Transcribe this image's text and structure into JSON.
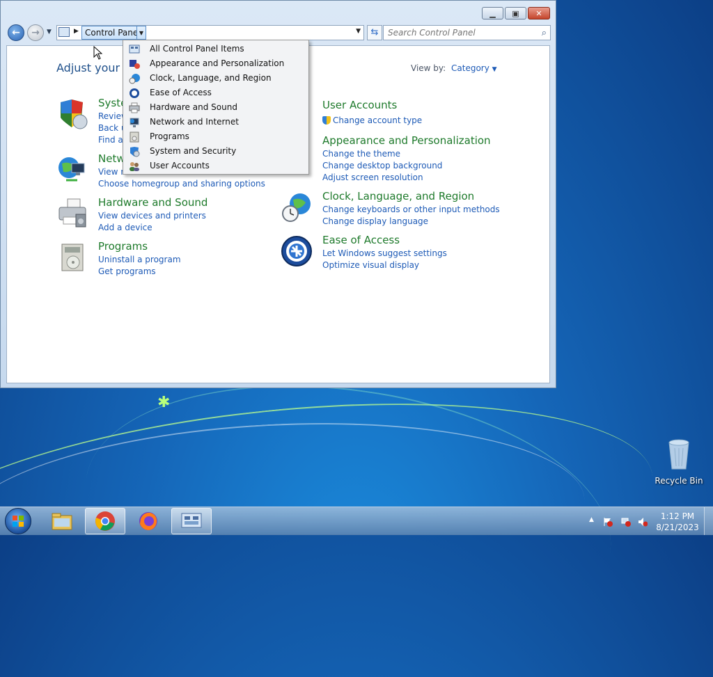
{
  "window": {
    "caption_buttons": {
      "minimize": "minimize-icon",
      "maximize": "maximize-icon",
      "close": "close-icon"
    },
    "nav": {
      "breadcrumb": "Control Panel",
      "search_placeholder": "Search Control Panel"
    },
    "content": {
      "heading": "Adjust your co",
      "view_by_label": "View by:",
      "view_by_value": "Category",
      "left_categories": [
        {
          "title": "Syste",
          "links": [
            "Review",
            "Back u",
            "Find ar"
          ],
          "icon": "shield-icon"
        },
        {
          "title": "Netw",
          "links": [
            "View n",
            "Choose homegroup and sharing options"
          ],
          "icon": "network-globe-icon"
        },
        {
          "title": "Hardware and Sound",
          "links": [
            "View devices and printers",
            "Add a device"
          ],
          "icon": "printer-icon"
        },
        {
          "title": "Programs",
          "links": [
            "Uninstall a program",
            "Get programs"
          ],
          "icon": "programs-icon"
        }
      ],
      "right_categories": [
        {
          "title": "User Accounts",
          "links": [
            "Change account type"
          ],
          "icon": "users-icon"
        },
        {
          "title": "Appearance and Personalization",
          "links": [
            "Change the theme",
            "Change desktop background",
            "Adjust screen resolution"
          ],
          "icon": "appearance-icon"
        },
        {
          "title": "Clock, Language, and Region",
          "links": [
            "Change keyboards or other input methods",
            "Change display language"
          ],
          "icon": "clock-globe-icon"
        },
        {
          "title": "Ease of Access",
          "links": [
            "Let Windows suggest settings",
            "Optimize visual display"
          ],
          "icon": "ease-of-access-icon"
        }
      ]
    },
    "dropdown": {
      "items": [
        {
          "label": "All Control Panel Items",
          "icon": "control-panel-icon"
        },
        {
          "label": "Appearance and Personalization",
          "icon": "appearance-icon"
        },
        {
          "label": "Clock, Language, and Region",
          "icon": "clock-globe-icon"
        },
        {
          "label": "Ease of Access",
          "icon": "ease-of-access-icon"
        },
        {
          "label": "Hardware and Sound",
          "icon": "printer-icon"
        },
        {
          "label": "Network and Internet",
          "icon": "network-icon"
        },
        {
          "label": "Programs",
          "icon": "programs-icon"
        },
        {
          "label": "System and Security",
          "icon": "system-security-icon"
        },
        {
          "label": "User Accounts",
          "icon": "users-icon"
        }
      ]
    }
  },
  "desktop": {
    "recycle_bin_label": "Recycle Bin"
  },
  "taskbar": {
    "apps": [
      "file-explorer-icon",
      "chrome-icon",
      "firefox-icon",
      "control-panel-icon"
    ],
    "clock_time": "1:12 PM",
    "clock_date": "8/21/2023"
  },
  "colors": {
    "link_blue": "#1d5ab6",
    "category_green": "#1e7a2b",
    "heading_blue": "#1e4f8a"
  }
}
